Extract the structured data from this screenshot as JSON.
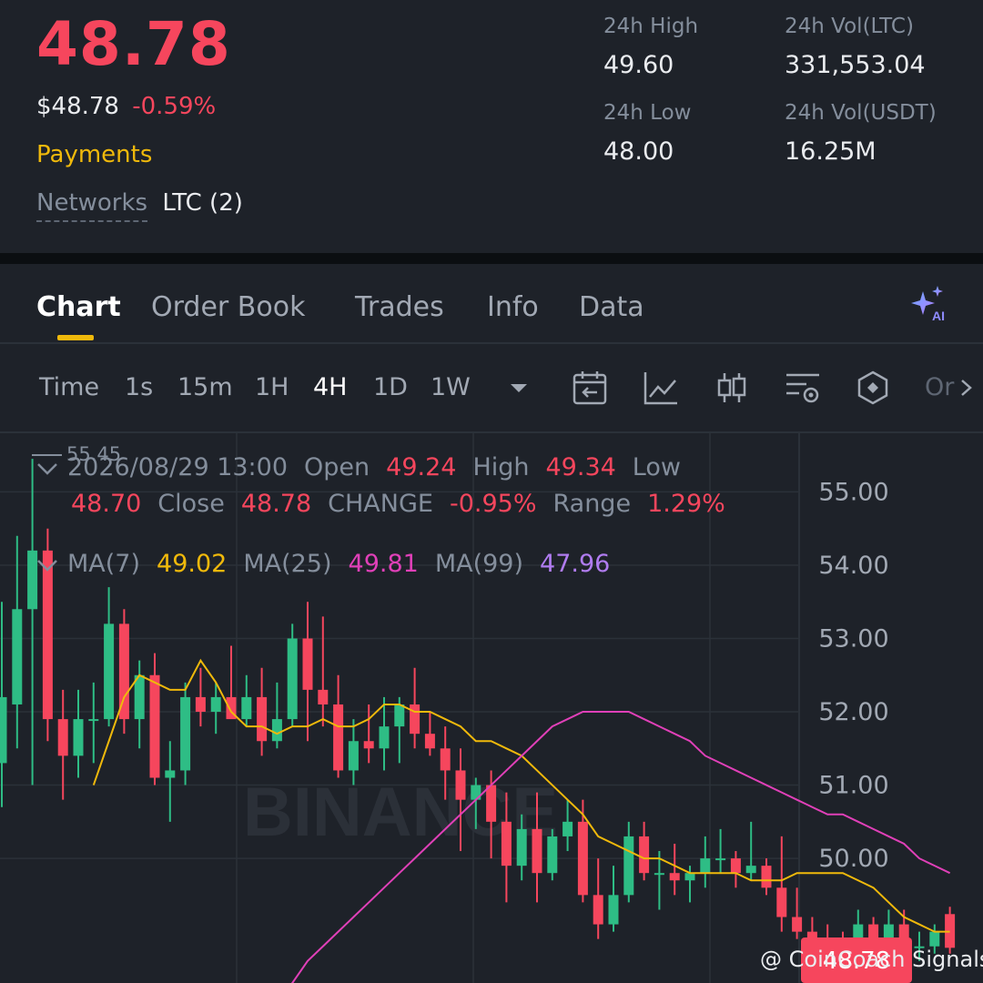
{
  "header": {
    "last_price": "48.78",
    "fiat_price": "$48.78",
    "change_pct": "-0.59%",
    "tag": "Payments",
    "networks_label": "Networks",
    "networks_value": "LTC (2)",
    "stats": {
      "high_label": "24h High",
      "high_value": "49.60",
      "low_label": "24h Low",
      "low_value": "48.00",
      "vol_ltc_label": "24h Vol(LTC)",
      "vol_ltc_value": "331,553.04",
      "vol_usdt_label": "24h Vol(USDT)",
      "vol_usdt_value": "16.25M"
    }
  },
  "tabs": [
    {
      "label": "Chart",
      "active": true
    },
    {
      "label": "Order Book"
    },
    {
      "label": "Trades"
    },
    {
      "label": "Info"
    },
    {
      "label": "Data"
    }
  ],
  "toolbar": {
    "timeframes": [
      "Time",
      "1s",
      "15m",
      "1H",
      "4H",
      "1D",
      "1W"
    ],
    "active_timeframe": "4H",
    "more_label": "Or"
  },
  "candle_info": {
    "datetime": "2026/08/29 13:00",
    "open_label": "Open",
    "open": "49.24",
    "high_label": "High",
    "high": "49.34",
    "low_label": "Low",
    "low": "48.70",
    "close_label": "Close",
    "close": "48.78",
    "change_label": "CHANGE",
    "change": "-0.95%",
    "range_label": "Range",
    "range": "1.29%"
  },
  "ma_info": {
    "ma7_label": "MA(7)",
    "ma7": "49.02",
    "ma25_label": "MA(25)",
    "ma25": "49.81",
    "ma99_label": "MA(99)",
    "ma99": "47.96"
  },
  "watermark": "BINANCE",
  "credit": "@ CoinCoach Signals",
  "colors": {
    "up": "#2ebd85",
    "down": "#f6465d",
    "accent": "#f0b90b",
    "ma7": "#f0b90b",
    "ma25": "#e040b8",
    "ma99": "#b07cf0"
  },
  "chart_data": {
    "type": "candlestick",
    "y_ticks": [
      "55.00",
      "54.00",
      "53.00",
      "52.00",
      "51.00",
      "50.00"
    ],
    "y_range": [
      48.3,
      55.8
    ],
    "max_label": "55.45",
    "current_price_label": "48.78",
    "candles": [
      {
        "o": 51.3,
        "h": 53.5,
        "l": 50.7,
        "c": 52.2
      },
      {
        "o": 52.1,
        "h": 54.4,
        "l": 51.5,
        "c": 53.4
      },
      {
        "o": 53.4,
        "h": 55.45,
        "l": 51.0,
        "c": 54.2
      },
      {
        "o": 54.2,
        "h": 54.5,
        "l": 51.6,
        "c": 51.9
      },
      {
        "o": 51.9,
        "h": 52.3,
        "l": 50.8,
        "c": 51.4
      },
      {
        "o": 51.4,
        "h": 52.3,
        "l": 51.1,
        "c": 51.9
      },
      {
        "o": 51.9,
        "h": 52.4,
        "l": 51.3,
        "c": 51.9
      },
      {
        "o": 51.9,
        "h": 53.7,
        "l": 51.8,
        "c": 53.2
      },
      {
        "o": 53.2,
        "h": 53.4,
        "l": 51.7,
        "c": 51.9
      },
      {
        "o": 51.9,
        "h": 52.7,
        "l": 51.5,
        "c": 52.5
      },
      {
        "o": 52.5,
        "h": 52.8,
        "l": 51.0,
        "c": 51.1
      },
      {
        "o": 51.1,
        "h": 51.6,
        "l": 50.5,
        "c": 51.2
      },
      {
        "o": 51.2,
        "h": 52.4,
        "l": 51.0,
        "c": 52.2
      },
      {
        "o": 52.2,
        "h": 52.6,
        "l": 51.8,
        "c": 52.0
      },
      {
        "o": 52.0,
        "h": 52.4,
        "l": 51.7,
        "c": 52.2
      },
      {
        "o": 52.2,
        "h": 52.9,
        "l": 52.0,
        "c": 51.9
      },
      {
        "o": 51.9,
        "h": 52.5,
        "l": 51.8,
        "c": 52.2
      },
      {
        "o": 52.2,
        "h": 52.6,
        "l": 51.4,
        "c": 51.6
      },
      {
        "o": 51.6,
        "h": 52.4,
        "l": 51.5,
        "c": 51.9
      },
      {
        "o": 51.9,
        "h": 53.2,
        "l": 51.8,
        "c": 53.0
      },
      {
        "o": 53.0,
        "h": 53.5,
        "l": 51.6,
        "c": 52.3
      },
      {
        "o": 52.3,
        "h": 53.3,
        "l": 51.8,
        "c": 52.1
      },
      {
        "o": 52.1,
        "h": 52.5,
        "l": 51.1,
        "c": 51.2
      },
      {
        "o": 51.2,
        "h": 51.9,
        "l": 51.0,
        "c": 51.6
      },
      {
        "o": 51.6,
        "h": 52.1,
        "l": 51.3,
        "c": 51.5
      },
      {
        "o": 51.5,
        "h": 52.2,
        "l": 51.2,
        "c": 51.8
      },
      {
        "o": 51.8,
        "h": 52.2,
        "l": 51.3,
        "c": 52.1
      },
      {
        "o": 52.1,
        "h": 52.6,
        "l": 51.5,
        "c": 51.7
      },
      {
        "o": 51.7,
        "h": 52.0,
        "l": 51.4,
        "c": 51.5
      },
      {
        "o": 51.5,
        "h": 51.8,
        "l": 50.8,
        "c": 51.2
      },
      {
        "o": 51.2,
        "h": 51.5,
        "l": 50.1,
        "c": 50.8
      },
      {
        "o": 50.8,
        "h": 51.1,
        "l": 50.4,
        "c": 51.0
      },
      {
        "o": 51.0,
        "h": 51.2,
        "l": 50.0,
        "c": 50.5
      },
      {
        "o": 50.5,
        "h": 50.9,
        "l": 49.4,
        "c": 49.9
      },
      {
        "o": 49.9,
        "h": 50.6,
        "l": 49.7,
        "c": 50.4
      },
      {
        "o": 50.4,
        "h": 50.9,
        "l": 49.4,
        "c": 49.8
      },
      {
        "o": 49.8,
        "h": 50.4,
        "l": 49.7,
        "c": 50.3
      },
      {
        "o": 50.3,
        "h": 50.8,
        "l": 50.1,
        "c": 50.5
      },
      {
        "o": 50.5,
        "h": 50.8,
        "l": 49.4,
        "c": 49.5
      },
      {
        "o": 49.5,
        "h": 50.0,
        "l": 48.9,
        "c": 49.1
      },
      {
        "o": 49.1,
        "h": 49.9,
        "l": 49.0,
        "c": 49.5
      },
      {
        "o": 49.5,
        "h": 50.5,
        "l": 49.4,
        "c": 50.3
      },
      {
        "o": 50.3,
        "h": 50.5,
        "l": 49.7,
        "c": 49.8
      },
      {
        "o": 49.8,
        "h": 50.1,
        "l": 49.3,
        "c": 49.8
      },
      {
        "o": 49.8,
        "h": 50.2,
        "l": 49.5,
        "c": 49.7
      },
      {
        "o": 49.7,
        "h": 49.9,
        "l": 49.4,
        "c": 49.8
      },
      {
        "o": 49.8,
        "h": 50.3,
        "l": 49.6,
        "c": 50.0
      },
      {
        "o": 50.0,
        "h": 50.4,
        "l": 49.8,
        "c": 50.0
      },
      {
        "o": 50.0,
        "h": 50.1,
        "l": 49.6,
        "c": 49.8
      },
      {
        "o": 49.8,
        "h": 50.5,
        "l": 49.7,
        "c": 49.9
      },
      {
        "o": 49.9,
        "h": 50.0,
        "l": 49.5,
        "c": 49.6
      },
      {
        "o": 49.6,
        "h": 50.3,
        "l": 49.0,
        "c": 49.2
      },
      {
        "o": 49.2,
        "h": 49.6,
        "l": 48.9,
        "c": 49.0
      },
      {
        "o": 49.0,
        "h": 49.2,
        "l": 48.7,
        "c": 48.9
      },
      {
        "o": 48.9,
        "h": 49.1,
        "l": 48.5,
        "c": 48.7
      },
      {
        "o": 48.7,
        "h": 49.0,
        "l": 48.5,
        "c": 48.6
      },
      {
        "o": 48.6,
        "h": 49.3,
        "l": 48.4,
        "c": 49.1
      },
      {
        "o": 49.1,
        "h": 49.2,
        "l": 48.7,
        "c": 48.8
      },
      {
        "o": 48.8,
        "h": 49.3,
        "l": 48.7,
        "c": 49.1
      },
      {
        "o": 49.1,
        "h": 49.3,
        "l": 48.6,
        "c": 48.8
      },
      {
        "o": 48.8,
        "h": 49.0,
        "l": 48.6,
        "c": 48.8
      },
      {
        "o": 48.8,
        "h": 49.1,
        "l": 48.7,
        "c": 49.0
      },
      {
        "o": 49.24,
        "h": 49.34,
        "l": 48.7,
        "c": 48.78
      }
    ],
    "ma7": [
      51.0,
      51.6,
      52.2,
      52.5,
      52.4,
      52.3,
      52.3,
      52.7,
      52.4,
      52.0,
      51.8,
      51.8,
      51.7,
      51.8,
      51.8,
      51.9,
      51.8,
      51.8,
      51.9,
      52.1,
      52.1,
      52.0,
      52.0,
      51.9,
      51.8,
      51.6,
      51.6,
      51.5,
      51.4,
      51.2,
      51.0,
      50.8,
      50.6,
      50.3,
      50.2,
      50.1,
      50.0,
      50.0,
      49.9,
      49.8,
      49.8,
      49.8,
      49.8,
      49.7,
      49.7,
      49.7,
      49.8,
      49.8,
      49.8,
      49.8,
      49.7,
      49.6,
      49.4,
      49.2,
      49.1,
      49.0,
      49.0
    ],
    "ma25": [
      47.9,
      48.1,
      48.3,
      48.6,
      48.8,
      49.0,
      49.2,
      49.4,
      49.6,
      49.8,
      50.0,
      50.2,
      50.4,
      50.6,
      50.8,
      51.0,
      51.2,
      51.4,
      51.6,
      51.8,
      51.9,
      52.0,
      52.0,
      52.0,
      52.0,
      51.9,
      51.8,
      51.7,
      51.6,
      51.4,
      51.3,
      51.2,
      51.1,
      51.0,
      50.9,
      50.8,
      50.7,
      50.6,
      50.6,
      50.5,
      50.4,
      50.3,
      50.2,
      50.0,
      49.9,
      49.8
    ]
  }
}
